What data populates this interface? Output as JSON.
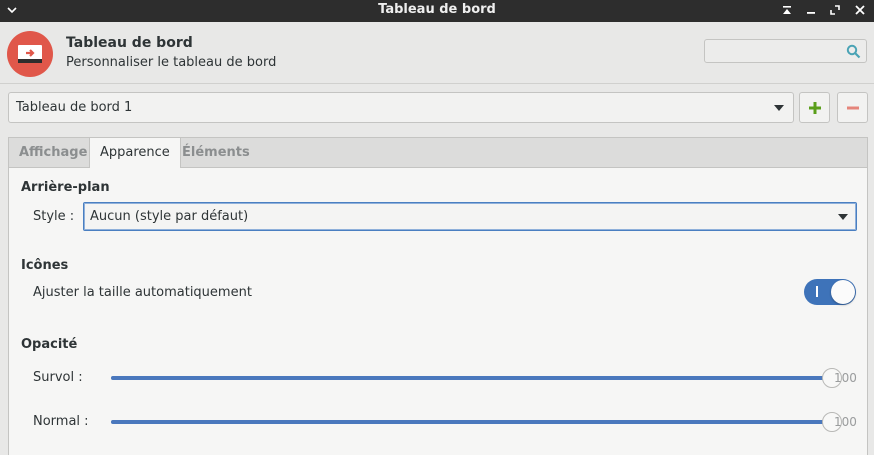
{
  "window": {
    "title": "Tableau de bord"
  },
  "header": {
    "title": "Tableau de bord",
    "subtitle": "Personnaliser le tableau de bord",
    "search": {
      "value": "",
      "placeholder": ""
    },
    "icon_color": "#e0574a"
  },
  "panel_selector": {
    "selected": "Tableau de bord 1",
    "add_label": "+",
    "remove_label": "−"
  },
  "tabs": [
    {
      "label": "Affichage",
      "active": false
    },
    {
      "label": "Apparence",
      "active": true
    },
    {
      "label": "Éléments",
      "active": false
    }
  ],
  "background": {
    "heading": "Arrière-plan",
    "style_label": "Style :",
    "style_value": "Aucun (style par défaut)"
  },
  "icons": {
    "heading": "Icônes",
    "auto_resize_label": "Ajuster la taille automatiquement",
    "auto_resize_on": true
  },
  "opacity": {
    "heading": "Opacité",
    "hover": {
      "label": "Survol :",
      "value": 100,
      "value_text": "100"
    },
    "normal": {
      "label": "Normal :",
      "value": 100,
      "value_text": "100"
    }
  },
  "colors": {
    "accent": "#4a78bd",
    "toggle_on": "#3e73b9",
    "add_green": "#5a9e1a",
    "remove_red": "#e0574a"
  }
}
